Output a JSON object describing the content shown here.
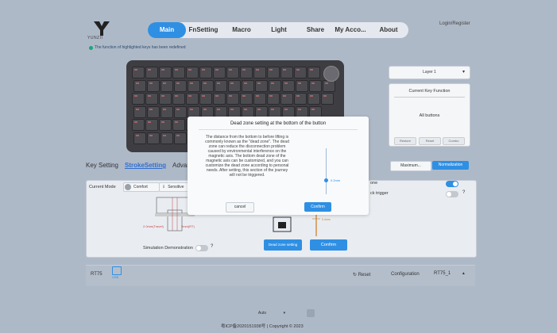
{
  "header": {
    "logo_text": "YUNZII",
    "nav": [
      "Main",
      "FnSetting",
      "Macro",
      "Light",
      "Share",
      "My Acco...",
      "About"
    ],
    "active_nav": "Main",
    "login": "Login/Register"
  },
  "notice": "The function of highlighted keys has been redefined",
  "right_panel": {
    "layer": "Layer 1",
    "current_key_title": "Current Key Function",
    "current_key_value": "All buttons",
    "buttons": [
      "Restore",
      "Reset",
      "Combo"
    ]
  },
  "tabs": [
    "Key Setting",
    "StrokeSetting",
    "Advan"
  ],
  "active_tab": "StrokeSetting",
  "mode_buttons": {
    "max": "Maximum...",
    "normal": "Normalization"
  },
  "stroke": {
    "current_mode_label": "Current Mode",
    "comfort": "Comfort",
    "sensitive": "Sensitive",
    "option1_label": "one",
    "option2_label": "ck trigger",
    "travel_left": "2.0mm(Travel)",
    "travel_right": "2mm(RT)",
    "simulation_label": "Simulation Demonstration",
    "dead_zone_button": "Dead zone setting",
    "confirm_button": "Confirm",
    "diagram_val": "0.4mm"
  },
  "footer": {
    "left_label": "RT75",
    "usb_label": "USB",
    "reset": "Reset",
    "config": "Configuration",
    "rt_select": "RT75_1"
  },
  "modal": {
    "title": "Dead zone setting at the bottom of the button",
    "body": "The distance from the bottom to before lifting is commonly known as the \"dead zone\". The dead zone can reduce the disconnection problem caused by environmental interference on the magnetic axis. The bottom dead zone of the magnetic axis can be customized, and you can customize the dead zone according to personal needs. After setting, this section of the journey will not be triggered.",
    "slider_value": "0.2mm",
    "cancel": "cancel",
    "confirm": "Confirm"
  },
  "bottom": {
    "select_value": "Auto",
    "copyright": "粤ICP备2020151938号 | Copyright © 2023"
  }
}
